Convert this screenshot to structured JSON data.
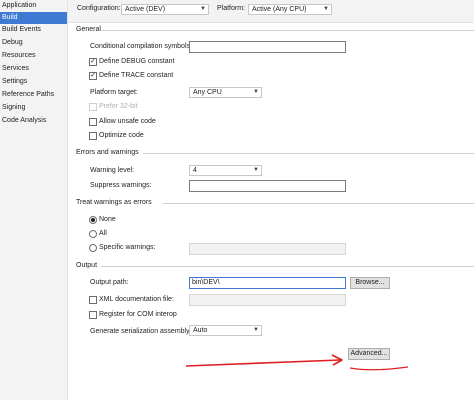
{
  "nav": {
    "items": [
      {
        "label": "Application"
      },
      {
        "label": "Build"
      },
      {
        "label": "Build Events"
      },
      {
        "label": "Debug"
      },
      {
        "label": "Resources"
      },
      {
        "label": "Services"
      },
      {
        "label": "Settings"
      },
      {
        "label": "Reference Paths"
      },
      {
        "label": "Signing"
      },
      {
        "label": "Code Analysis"
      }
    ],
    "active": "Build"
  },
  "header": {
    "configuration_label": "Configuration:",
    "configuration_value": "Active (DEV)",
    "platform_label": "Platform:",
    "platform_value": "Active (Any CPU)"
  },
  "general": {
    "title": "General",
    "conditional_symbols_label": "Conditional compilation symbols:",
    "conditional_symbols_value": "",
    "define_debug_label": "Define DEBUG constant",
    "define_debug_checked": true,
    "define_trace_label": "Define TRACE constant",
    "define_trace_checked": true,
    "platform_target_label": "Platform target:",
    "platform_target_value": "Any CPU",
    "prefer32_label": "Prefer 32-bit",
    "allow_unsafe_label": "Allow unsafe code",
    "optimize_label": "Optimize code"
  },
  "errors": {
    "title": "Errors and warnings",
    "warning_level_label": "Warning level:",
    "warning_level_value": "4",
    "suppress_label": "Suppress warnings:",
    "suppress_value": ""
  },
  "treat": {
    "title": "Treat warnings as errors",
    "none_label": "None",
    "all_label": "All",
    "specific_label": "Specific warnings:",
    "selected": "None"
  },
  "output": {
    "title": "Output",
    "path_label": "Output path:",
    "path_value": "bin\\DEV\\",
    "browse_label": "Browse...",
    "xml_label": "XML documentation file:",
    "com_label": "Register for COM interop",
    "serialization_label": "Generate serialization assembly:",
    "serialization_value": "Auto",
    "advanced_label": "Advanced..."
  },
  "colors": {
    "nav_active": "#3e79d4",
    "annotation": "#e02020"
  }
}
